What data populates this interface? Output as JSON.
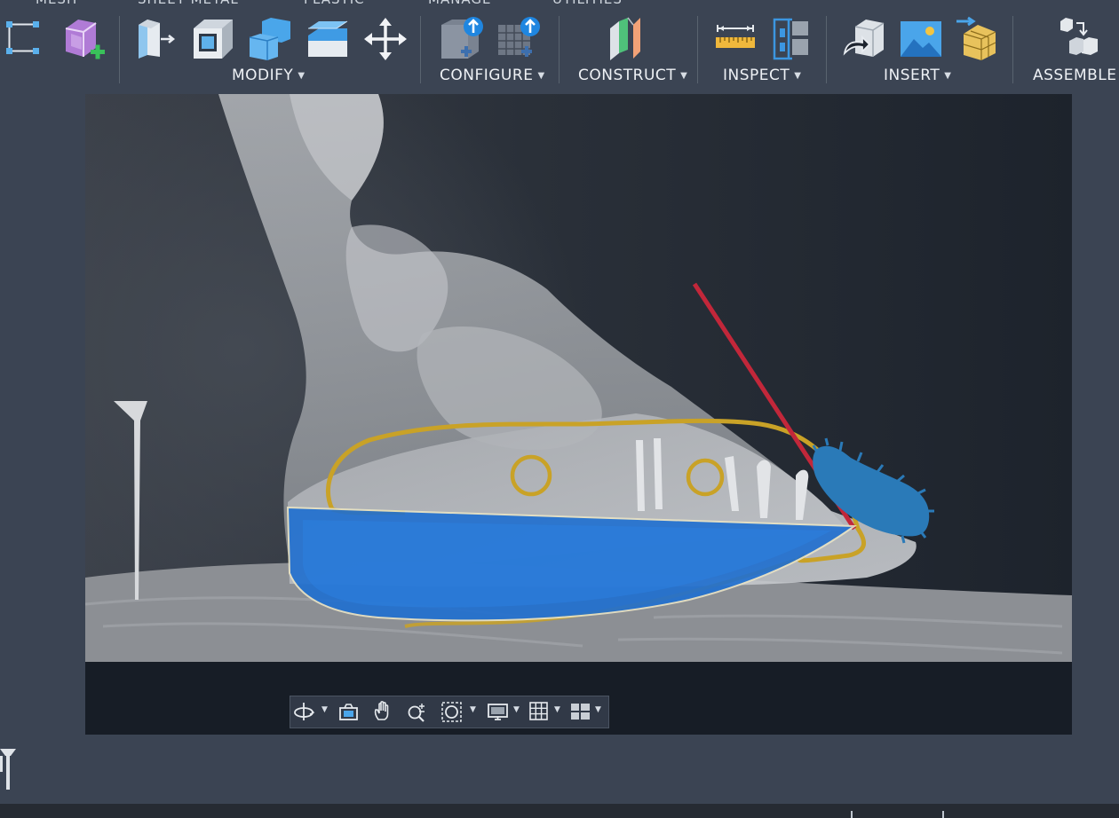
{
  "toolbar": {
    "tab_peek": [
      "MESH",
      "SHEET METAL",
      "PLASTIC",
      "MANAGE",
      "UTILITIES"
    ],
    "groups": [
      {
        "label": "MODIFY"
      },
      {
        "label": "CONFIGURE"
      },
      {
        "label": "CONSTRUCT"
      },
      {
        "label": "INSPECT"
      },
      {
        "label": "INSERT"
      },
      {
        "label": "ASSEMBLE"
      }
    ],
    "caret": "▼"
  },
  "colors": {
    "accent_blue": "#1f6fd0",
    "outline_gold": "#c9a227",
    "line_red": "#c2273a",
    "toolbar_bg": "#3b4453",
    "canvas_bg": "#171d26"
  },
  "icons": [
    "sketch-dimension-icon",
    "form-add-icon",
    "press-pull-icon",
    "shell-icon",
    "combine-icon",
    "offset-face-icon",
    "move-copy-icon",
    "configure-table-icon",
    "configure-grid-icon",
    "construct-plane-icon",
    "measure-icon",
    "section-analysis-icon",
    "insert-derive-icon",
    "canvas-image-icon",
    "insert-mesh-icon",
    "assemble-joint-icon"
  ],
  "navbar": {
    "icons": [
      "orbit-icon",
      "look-at-icon",
      "pan-icon",
      "zoom-icon",
      "fit-icon",
      "display-settings-icon",
      "grid-settings-icon",
      "viewports-icon"
    ]
  }
}
